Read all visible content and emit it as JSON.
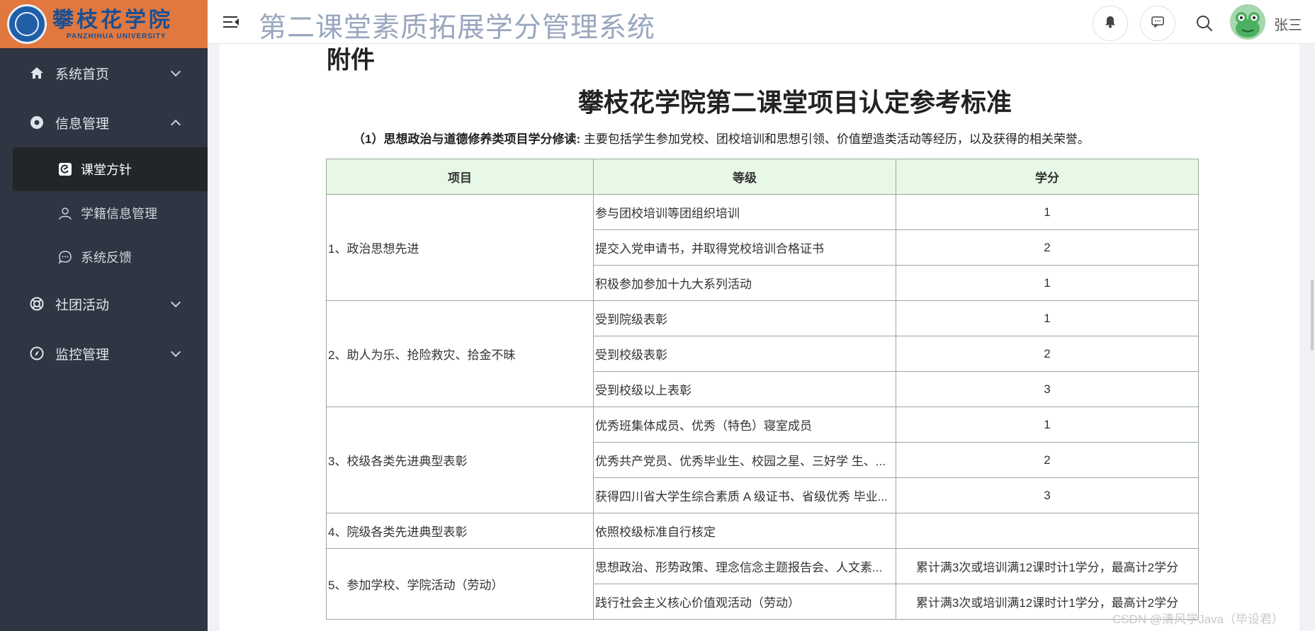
{
  "logo": {
    "cn": "攀枝花学院",
    "en": "PANZHIHUA UNIVERSITY"
  },
  "header": {
    "title": "第二课堂素质拓展学分管理系统",
    "user_name": "张三"
  },
  "sidebar": {
    "items": [
      {
        "label": "系统首页",
        "icon": "home-icon",
        "expanded": false
      },
      {
        "label": "信息管理",
        "icon": "info-icon",
        "expanded": true,
        "children": [
          {
            "label": "课堂方针",
            "icon": "edit-icon",
            "active": true
          },
          {
            "label": "学籍信息管理",
            "icon": "user-icon",
            "active": false
          },
          {
            "label": "系统反馈",
            "icon": "chat-icon",
            "active": false
          }
        ]
      },
      {
        "label": "社团活动",
        "icon": "lifebuoy-icon",
        "expanded": false
      },
      {
        "label": "监控管理",
        "icon": "compass-icon",
        "expanded": false
      }
    ]
  },
  "document": {
    "heading": "附件",
    "title": "攀枝花学院第二课堂项目认定参考标准",
    "desc_bold": "（1）思想政治与道德修养类项目学分修读:",
    "desc_text": " 主要包括学生参加党校、团校培训和思想引领、价值塑造类活动等经历，以及获得的相关荣誉。",
    "table": {
      "headers": [
        "项目",
        "等级",
        "学分"
      ],
      "groups": [
        {
          "project": "1、政治思想先进",
          "rows": [
            {
              "level": "参与团校培训等团组织培训",
              "credit": "1"
            },
            {
              "level": "提交入党申请书，并取得党校培训合格证书",
              "credit": "2"
            },
            {
              "level": "积极参加参加十九大系列活动",
              "credit": "1"
            }
          ]
        },
        {
          "project": "2、助人为乐、抢险救灾、拾金不昧",
          "rows": [
            {
              "level": "受到院级表彰",
              "credit": "1"
            },
            {
              "level": "受到校级表彰",
              "credit": "2"
            },
            {
              "level": "受到校级以上表彰",
              "credit": "3"
            }
          ]
        },
        {
          "project": "3、校级各类先进典型表彰",
          "rows": [
            {
              "level": "优秀班集体成员、优秀（特色）寝室成员",
              "credit": "1"
            },
            {
              "level": "优秀共产党员、优秀毕业生、校园之星、三好学 生、...",
              "credit": "2"
            },
            {
              "level": "获得四川省大学生综合素质 A 级证书、省级优秀 毕业...",
              "credit": "3"
            }
          ]
        },
        {
          "project": "4、院级各类先进典型表彰",
          "rows": [
            {
              "level": "依照校级标准自行核定",
              "credit": ""
            }
          ]
        },
        {
          "project": "5、参加学校、学院活动（劳动）",
          "rows": [
            {
              "level": "思想政治、形势政策、理念信念主题报告会、人文素...",
              "credit": "累计满3次或培训满12课时计1学分，最高计2学分"
            },
            {
              "level": "践行社会主义核心价值观活动（劳动）",
              "credit": "累计满3次或培训满12课时计1学分，最高计2学分"
            }
          ]
        }
      ]
    }
  },
  "watermark": "CSDN @清风学Java（毕设君）"
}
